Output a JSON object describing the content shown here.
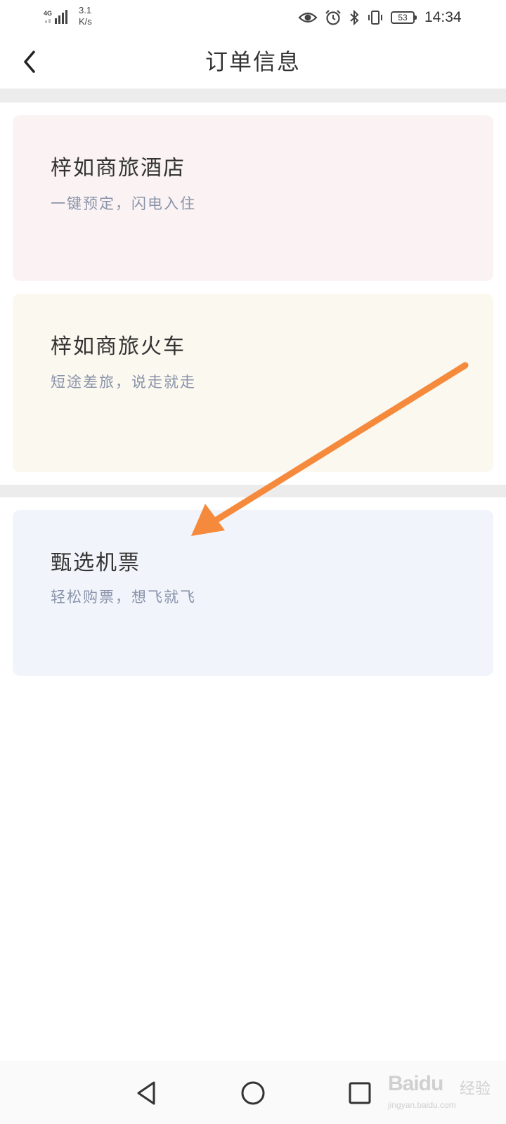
{
  "status_bar": {
    "network_type": "4G",
    "speed_value": "3.1",
    "speed_unit": "K/s",
    "battery_level": "53",
    "time": "14:34",
    "icons": [
      "eye-icon",
      "alarm-icon",
      "bluetooth-icon",
      "vibrate-icon",
      "battery-icon"
    ]
  },
  "header": {
    "title": "订单信息",
    "back_icon": "chevron-left-icon"
  },
  "cards": [
    {
      "title": "梓如商旅酒店",
      "subtitle": "一键预定，闪电入住",
      "bg": "#fbf3f3"
    },
    {
      "title": "梓如商旅火车",
      "subtitle": "短途差旅，说走就走",
      "bg": "#fbf8ef"
    },
    {
      "title": "甄选机票",
      "subtitle": "轻松购票，想飞就飞",
      "bg": "#f1f5fb"
    }
  ],
  "annotation": {
    "arrow_color": "#f58a3c"
  },
  "nav_bar": {
    "buttons": [
      "triangle-back-icon",
      "circle-home-icon",
      "square-recent-icon"
    ]
  },
  "watermark": {
    "brand": "Baidu",
    "suffix": "经验",
    "url": "jingyan.baidu.com"
  }
}
